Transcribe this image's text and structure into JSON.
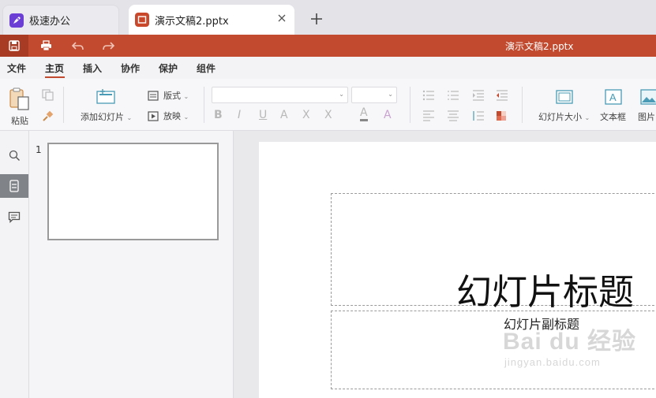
{
  "tabs": {
    "home": {
      "label": "极速办公"
    },
    "document": {
      "label": "演示文稿2.pptx"
    }
  },
  "quickbar": {
    "doc_title": "演示文稿2.pptx",
    "accent_color": "#c14a2f"
  },
  "menu": {
    "items": [
      "文件",
      "主页",
      "插入",
      "协作",
      "保护",
      "组件"
    ],
    "active": "主页"
  },
  "ribbon": {
    "paste_label": "粘贴",
    "add_slide_label": "添加幻灯片",
    "layout_label": "版式",
    "play_label": "放映",
    "font_name_value": "",
    "font_size_value": "",
    "bold_label": "B",
    "italic_label": "I",
    "underline_label": "U",
    "strike_label": "A",
    "superscript_label": "X",
    "subscript_label": "X",
    "font_color_label": "A",
    "clear_format_label": "A",
    "slide_size_label": "幻灯片大小",
    "textbox_label": "文本框",
    "picture_label": "图片"
  },
  "thumbnails": [
    {
      "number": "1"
    }
  ],
  "slide": {
    "title": "幻灯片标题",
    "subtitle": "幻灯片副标题"
  },
  "watermark": {
    "main": "Bai du 经验",
    "url": "jingyan.baidu.com"
  },
  "icons": [
    "rocket-logo-icon",
    "presentation-logo-icon",
    "close-icon",
    "plus-icon",
    "save-icon",
    "print-icon",
    "undo-icon",
    "redo-icon",
    "paste-icon",
    "copy-icon",
    "format-painter-icon",
    "add-slide-icon",
    "layout-icon",
    "play-icon",
    "bullets-icon",
    "numbering-icon",
    "indent-icon",
    "align-left-icon",
    "align-center-icon",
    "line-spacing-icon",
    "shading-icon",
    "slide-size-icon",
    "textbox-icon",
    "picture-icon",
    "search-icon",
    "slides-icon",
    "comment-icon"
  ]
}
